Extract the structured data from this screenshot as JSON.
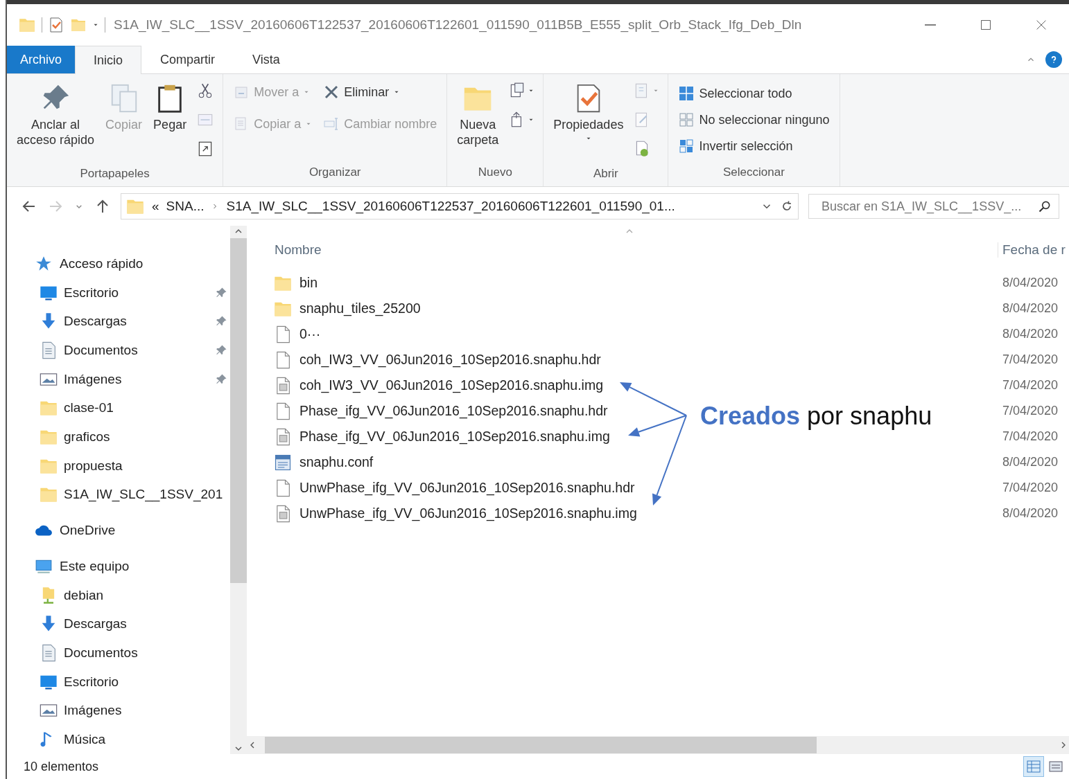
{
  "window": {
    "title": "S1A_IW_SLC__1SSV_20160606T122537_20160606T122601_011590_011B5B_E555_split_Orb_Stack_Ifg_Deb_Dln"
  },
  "ribbon_tabs": [
    {
      "label": "Archivo",
      "kind": "file",
      "selected": false
    },
    {
      "label": "Inicio",
      "kind": "tab",
      "selected": true
    },
    {
      "label": "Compartir",
      "kind": "tab",
      "selected": false
    },
    {
      "label": "Vista",
      "kind": "tab",
      "selected": false
    }
  ],
  "ribbon_groups": [
    {
      "label": "Portapapeles",
      "columns": [
        [
          {
            "kind": "large",
            "lines": [
              "Anclar al",
              "acceso rápido"
            ],
            "disabled": false,
            "dropdown": false
          }
        ],
        [
          {
            "kind": "large",
            "lines": [
              "Copiar"
            ],
            "disabled": true,
            "dropdown": false
          }
        ],
        [
          {
            "kind": "large",
            "lines": [
              "Pegar"
            ],
            "disabled": false,
            "dropdown": false
          }
        ],
        [
          {
            "kind": "icon",
            "disabled": false,
            "dropdown": false
          },
          {
            "kind": "icon",
            "disabled": true,
            "dropdown": false
          },
          {
            "kind": "icon",
            "disabled": false,
            "dropdown": false
          }
        ]
      ]
    },
    {
      "label": "Organizar",
      "columns": [
        [
          {
            "kind": "small",
            "label": "Mover a",
            "disabled": true,
            "dropdown": true
          },
          {
            "kind": "small",
            "label": "Copiar a",
            "disabled": true,
            "dropdown": true
          }
        ],
        [
          {
            "kind": "small",
            "label": "Eliminar",
            "disabled": false,
            "dropdown": true
          },
          {
            "kind": "small",
            "label": "Cambiar nombre",
            "disabled": true,
            "dropdown": false
          }
        ]
      ]
    },
    {
      "label": "Nuevo",
      "columns": [
        [
          {
            "kind": "large",
            "lines": [
              "Nueva",
              "carpeta"
            ],
            "disabled": false,
            "dropdown": false
          }
        ],
        [
          {
            "kind": "icon",
            "disabled": false,
            "dropdown": true
          },
          {
            "kind": "icon",
            "disabled": false,
            "dropdown": true
          }
        ]
      ]
    },
    {
      "label": "Abrir",
      "columns": [
        [
          {
            "kind": "large",
            "lines": [
              "Propiedades"
            ],
            "disabled": false,
            "dropdown": true
          }
        ],
        [
          {
            "kind": "icon",
            "disabled": true,
            "dropdown": true
          },
          {
            "kind": "icon",
            "disabled": true,
            "dropdown": false
          },
          {
            "kind": "icon",
            "disabled": false,
            "dropdown": false
          }
        ]
      ]
    },
    {
      "label": "Seleccionar",
      "columns": [
        [
          {
            "kind": "small",
            "label": "Seleccionar todo",
            "disabled": false,
            "dropdown": false
          },
          {
            "kind": "small",
            "label": "No seleccionar ninguno",
            "disabled": false,
            "dropdown": false
          },
          {
            "kind": "small",
            "label": "Invertir selección",
            "disabled": false,
            "dropdown": false
          }
        ]
      ]
    }
  ],
  "address": {
    "overflow": "«",
    "crumbs": [
      "SNA...",
      "S1A_IW_SLC__1SSV_20160606T122537_20160606T122601_011590_01..."
    ]
  },
  "search": {
    "placeholder": "Buscar en S1A_IW_SLC__1SSV_..."
  },
  "nav": [
    {
      "label": "Acceso rápido",
      "kind": "star",
      "children": [
        {
          "label": "Escritorio",
          "kind": "desktop",
          "pinned": true
        },
        {
          "label": "Descargas",
          "kind": "download",
          "pinned": true
        },
        {
          "label": "Documentos",
          "kind": "document",
          "pinned": true
        },
        {
          "label": "Imágenes",
          "kind": "pictures",
          "pinned": true
        },
        {
          "label": "clase-01",
          "kind": "folder",
          "pinned": false
        },
        {
          "label": "graficos",
          "kind": "folder",
          "pinned": false
        },
        {
          "label": "propuesta",
          "kind": "folder",
          "pinned": false
        },
        {
          "label": "S1A_IW_SLC__1SSV_201",
          "kind": "folder",
          "pinned": false
        }
      ]
    },
    {
      "label": "OneDrive",
      "kind": "cloud"
    },
    {
      "label": "Este equipo",
      "kind": "computer",
      "children": [
        {
          "label": "debian",
          "kind": "network-folder",
          "pinned": false
        },
        {
          "label": "Descargas",
          "kind": "download",
          "pinned": false
        },
        {
          "label": "Documentos",
          "kind": "document",
          "pinned": false
        },
        {
          "label": "Escritorio",
          "kind": "desktop",
          "pinned": false
        },
        {
          "label": "Imágenes",
          "kind": "pictures",
          "pinned": false
        },
        {
          "label": "Música",
          "kind": "music",
          "pinned": false
        }
      ]
    }
  ],
  "columns": [
    "Nombre",
    "Fecha de r"
  ],
  "files": [
    {
      "name": "bin",
      "kind": "folder",
      "date": "8/04/2020"
    },
    {
      "name": "snaphu_tiles_25200",
      "kind": "folder",
      "date": "8/04/2020"
    },
    {
      "name": "0···",
      "kind": "file",
      "date": "8/04/2020"
    },
    {
      "name": "coh_IW3_VV_06Jun2016_10Sep2016.snaphu.hdr",
      "kind": "file",
      "date": "7/04/2020"
    },
    {
      "name": "coh_IW3_VV_06Jun2016_10Sep2016.snaphu.img",
      "kind": "image",
      "date": "7/04/2020"
    },
    {
      "name": "Phase_ifg_VV_06Jun2016_10Sep2016.snaphu.hdr",
      "kind": "file",
      "date": "7/04/2020"
    },
    {
      "name": "Phase_ifg_VV_06Jun2016_10Sep2016.snaphu.img",
      "kind": "image",
      "date": "7/04/2020"
    },
    {
      "name": "snaphu.conf",
      "kind": "config",
      "date": "8/04/2020"
    },
    {
      "name": "UnwPhase_ifg_VV_06Jun2016_10Sep2016.snaphu.hdr",
      "kind": "file",
      "date": "7/04/2020"
    },
    {
      "name": "UnwPhase_ifg_VV_06Jun2016_10Sep2016.snaphu.img",
      "kind": "image",
      "date": "8/04/2020"
    }
  ],
  "status": {
    "count": "10 elementos"
  },
  "view_buttons": [
    {
      "kind": "details",
      "selected": true
    },
    {
      "kind": "tiles",
      "selected": false
    }
  ],
  "annotation": {
    "text": "**Creados** por snaphu"
  }
}
